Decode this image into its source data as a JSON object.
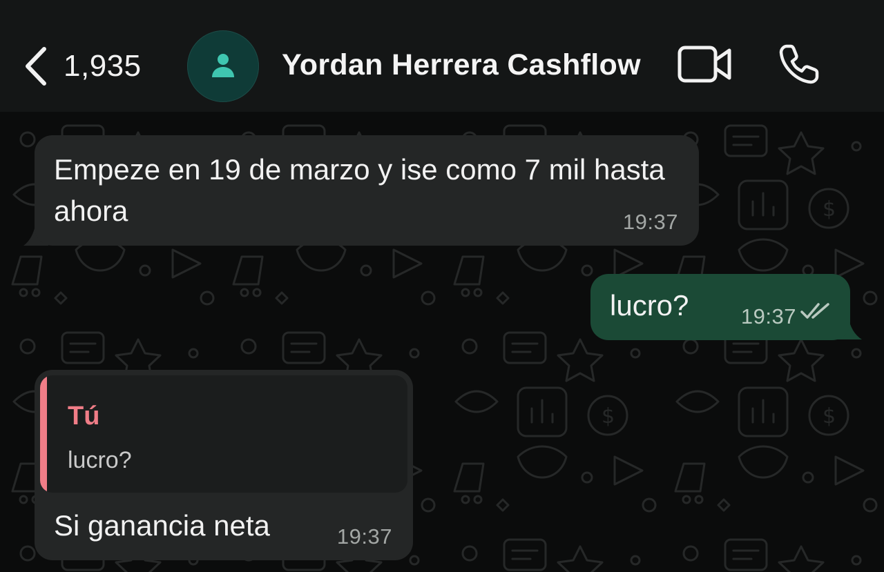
{
  "header": {
    "back_count": "1,935",
    "contact_name": "Yordan Herrera Cashflow",
    "icons": {
      "back": "chevron-left-icon",
      "avatar": "person-icon",
      "video": "video-camera-icon",
      "phone": "phone-icon"
    }
  },
  "messages": [
    {
      "direction": "incoming",
      "text": "Empeze en 19 de marzo y ise como 7 mil hasta ahora",
      "time": "19:37"
    },
    {
      "direction": "outgoing",
      "text": "lucro?",
      "time": "19:37",
      "status": "read-double-check"
    },
    {
      "direction": "incoming",
      "reply_to": {
        "author": "Tú",
        "text": "lucro?"
      },
      "text": "Si ganancia neta",
      "time": "19:37"
    }
  ],
  "colors": {
    "header_bg": "#141616",
    "chat_bg": "#0b0c0c",
    "incoming_bubble": "#242626",
    "outgoing_bubble": "#1b4a36",
    "quote_accent": "#f07d87",
    "avatar_bg": "#0f3b37",
    "avatar_icon": "#3fc6b0"
  }
}
